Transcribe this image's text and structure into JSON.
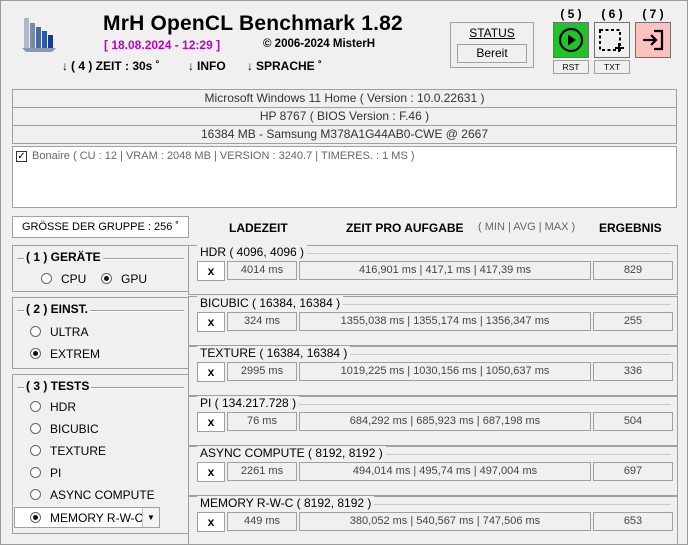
{
  "header": {
    "title": "MrH OpenCL Benchmark 1.82",
    "date": "[ 18.08.2024 - 12:29 ]",
    "copyright": "©  2006-2024 MisterH",
    "menu": [
      {
        "arrow": "↓",
        "label": "( 4 ) ZEIT : 30s ˚"
      },
      {
        "arrow": "↓",
        "label": "INFO"
      },
      {
        "arrow": "↓",
        "label": "SPRACHE ˚"
      }
    ]
  },
  "status": {
    "label": "STATUS",
    "value": "Bereit"
  },
  "buttons": [
    {
      "num": "( 5 )",
      "label": "RST",
      "icon": "play-icon",
      "color": "#22c22a"
    },
    {
      "num": "( 6 )",
      "label": "TXT",
      "icon": "screenshot-icon",
      "color": "#f0f0f0"
    },
    {
      "num": "( 7 )",
      "label": "",
      "icon": "exit-icon",
      "color": "#ffc0c0"
    }
  ],
  "system": {
    "os": "Microsoft Windows 11 Home ( Version : 10.0.22631 )",
    "bios": "HP 8767 ( BIOS Version : F.46 )",
    "memory": "16384 MB - Samsung M378A1G44AB0-CWE     @ 2667"
  },
  "device": "Bonaire ( CU : 12 | VRAM : 2048 MB | VERSION : 3240.7 | TIMERES. : 1 MS )",
  "group_size": "GRÖSSE DER GRUPPE : 256 ˚",
  "columns": {
    "load": "LADEZEIT",
    "time": "ZEIT PRO AUFGABE",
    "minmax": "( MIN | AVG | MAX )",
    "result": "ERGEBNIS"
  },
  "devices_panel": {
    "title": "( 1 ) GERÄTE",
    "options": [
      {
        "label": "CPU",
        "selected": false
      },
      {
        "label": "GPU",
        "selected": true
      }
    ]
  },
  "settings_panel": {
    "title": "( 2 ) EINST.",
    "options": [
      {
        "label": "ULTRA",
        "selected": false
      },
      {
        "label": "EXTREM",
        "selected": true
      }
    ]
  },
  "tests_panel": {
    "title": "( 3 ) TESTS",
    "options": [
      {
        "label": "HDR",
        "selected": false
      },
      {
        "label": "BICUBIC",
        "selected": false
      },
      {
        "label": "TEXTURE",
        "selected": false
      },
      {
        "label": "PI",
        "selected": false
      },
      {
        "label": "ASYNC COMPUTE",
        "selected": false
      },
      {
        "label": "MEMORY R-W-C",
        "selected": true
      }
    ]
  },
  "tests": [
    {
      "name": "HDR ( 4096, 4096 )",
      "x": "x",
      "load": "4014 ms",
      "time": "416,901 ms | 417,1 ms | 417,39 ms",
      "result": "829"
    },
    {
      "name": "BICUBIC ( 16384, 16384 )",
      "x": "x",
      "load": "324 ms",
      "time": "1355,038 ms | 1355,174 ms | 1356,347 ms",
      "result": "255"
    },
    {
      "name": "TEXTURE ( 16384, 16384 )",
      "x": "x",
      "load": "2995 ms",
      "time": "1019,225 ms | 1030,156 ms | 1050,637 ms",
      "result": "336"
    },
    {
      "name": "PI ( 134.217.728 )",
      "x": "x",
      "load": "76 ms",
      "time": "684,292 ms | 685,923 ms | 687,198 ms",
      "result": "504"
    },
    {
      "name": "ASYNC COMPUTE ( 8192, 8192 )",
      "x": "x",
      "load": "2261 ms",
      "time": "494,014 ms | 495,74 ms | 497,004 ms",
      "result": "697"
    },
    {
      "name": "MEMORY R-W-C ( 8192, 8192 )",
      "x": "x",
      "load": "449 ms",
      "time": "380,052 ms | 540,567 ms | 747,506 ms",
      "result": "653"
    }
  ]
}
